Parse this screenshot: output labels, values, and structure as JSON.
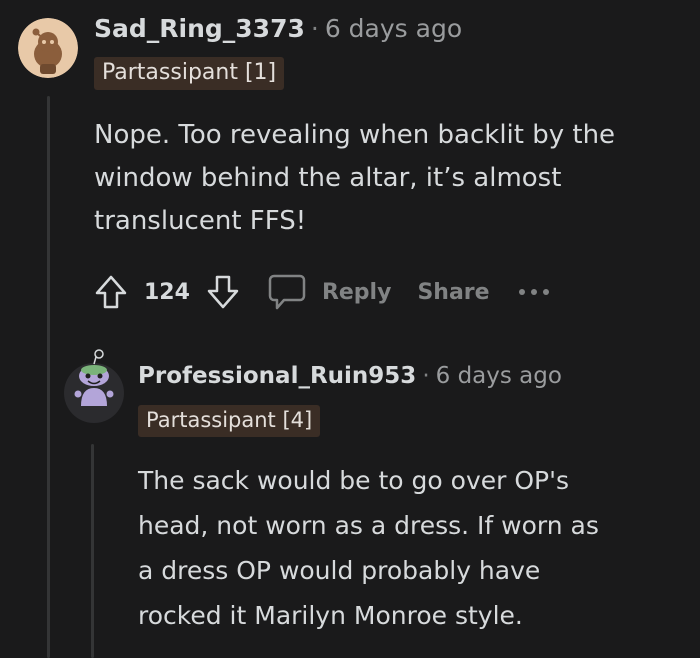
{
  "comments": [
    {
      "username": "Sad_Ring_3373",
      "separator": "·",
      "timestamp": "6 days ago",
      "flair": "Partassipant [1]",
      "body_lines": [
        "Nope. Too revealing when backlit by the",
        "window behind the altar, it’s almost",
        "translucent FFS!"
      ],
      "votes": "124",
      "reply_label": "Reply",
      "share_label": "Share"
    },
    {
      "username": "Professional_Ruin953",
      "separator": "·",
      "timestamp": "6 days ago",
      "flair": "Partassipant [4]",
      "body_lines": [
        "The sack would be to go over OP's",
        "head, not worn as a dress. If worn as",
        "a dress OP would probably have",
        "rocked it Marilyn Monroe style."
      ]
    }
  ],
  "colors": {
    "background": "#1a1a1b",
    "flair_bg": "#3a2d25",
    "text": "#d7dadc",
    "muted": "#818384"
  },
  "icons": [
    "upvote-icon",
    "downvote-icon",
    "comment-bubble-icon",
    "more-options-icon"
  ]
}
